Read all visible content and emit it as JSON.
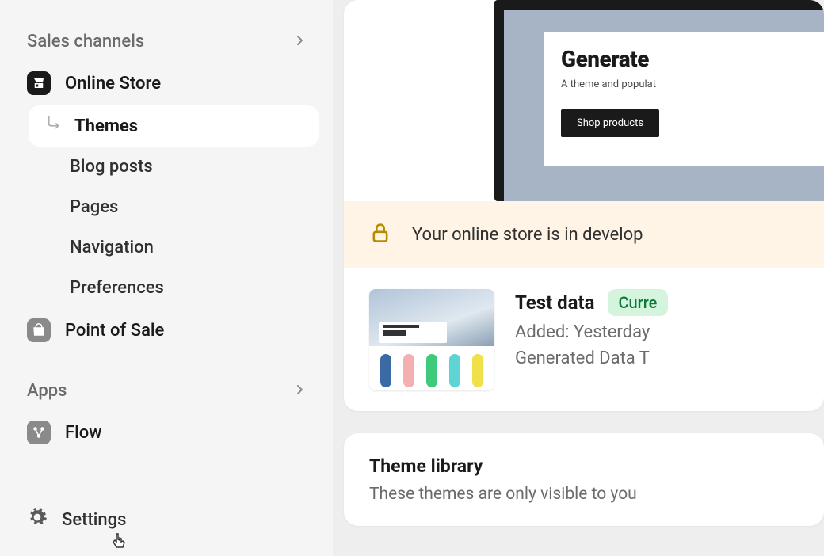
{
  "sidebar": {
    "sales_channels_header": "Sales channels",
    "online_store": "Online Store",
    "sub": {
      "themes": "Themes",
      "blog_posts": "Blog posts",
      "pages": "Pages",
      "navigation": "Navigation",
      "preferences": "Preferences"
    },
    "point_of_sale": "Point of Sale",
    "apps_header": "Apps",
    "flow": "Flow",
    "settings": "Settings"
  },
  "hero": {
    "title": "Generate",
    "subtitle": "A theme and populat",
    "button": "Shop products"
  },
  "banner": {
    "text": "Your online store is in develop"
  },
  "current_theme": {
    "name": "Test data",
    "badge": "Curre",
    "added": "Added: Yesterday",
    "generated": "Generated Data T"
  },
  "library": {
    "title": "Theme library",
    "subtitle": "These themes are only visible to you"
  },
  "colors": {
    "snowboards": [
      "#3a6ba5",
      "#f4b0b0",
      "#3fc97a",
      "#5fd4d4",
      "#f0e04a"
    ]
  }
}
